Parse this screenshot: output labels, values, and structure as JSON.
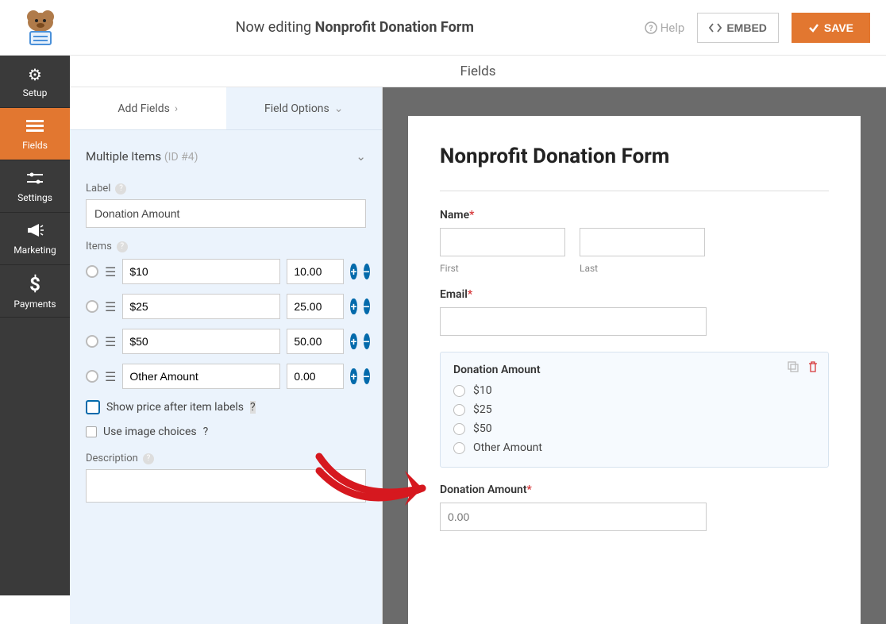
{
  "topbar": {
    "editing_prefix": "Now editing ",
    "form_name": "Nonprofit Donation Form",
    "help_label": "Help",
    "embed_label": "EMBED",
    "save_label": "SAVE"
  },
  "sidebar": {
    "items": [
      {
        "label": "Setup",
        "icon": "gear"
      },
      {
        "label": "Fields",
        "icon": "list"
      },
      {
        "label": "Settings",
        "icon": "sliders"
      },
      {
        "label": "Marketing",
        "icon": "megaphone"
      },
      {
        "label": "Payments",
        "icon": "dollar"
      }
    ]
  },
  "center_header": "Fields",
  "panel": {
    "tabs": {
      "add": "Add Fields",
      "options": "Field Options"
    },
    "section_title": "Multiple Items",
    "section_id": "(ID #4)",
    "label_heading": "Label",
    "label_value": "Donation Amount",
    "items_heading": "Items",
    "items": [
      {
        "label": "$10",
        "value": "10.00"
      },
      {
        "label": "$25",
        "value": "25.00"
      },
      {
        "label": "$50",
        "value": "50.00"
      },
      {
        "label": "Other Amount",
        "value": "0.00"
      }
    ],
    "show_price_label": "Show price after item labels",
    "use_images_label": "Use image choices",
    "description_heading": "Description"
  },
  "preview": {
    "title": "Nonprofit Donation Form",
    "name_label": "Name",
    "first_sub": "First",
    "last_sub": "Last",
    "email_label": "Email",
    "donation_label": "Donation Amount",
    "options": [
      "$10",
      "$25",
      "$50",
      "Other Amount"
    ],
    "amount_label": "Donation Amount",
    "amount_placeholder": "0.00"
  }
}
